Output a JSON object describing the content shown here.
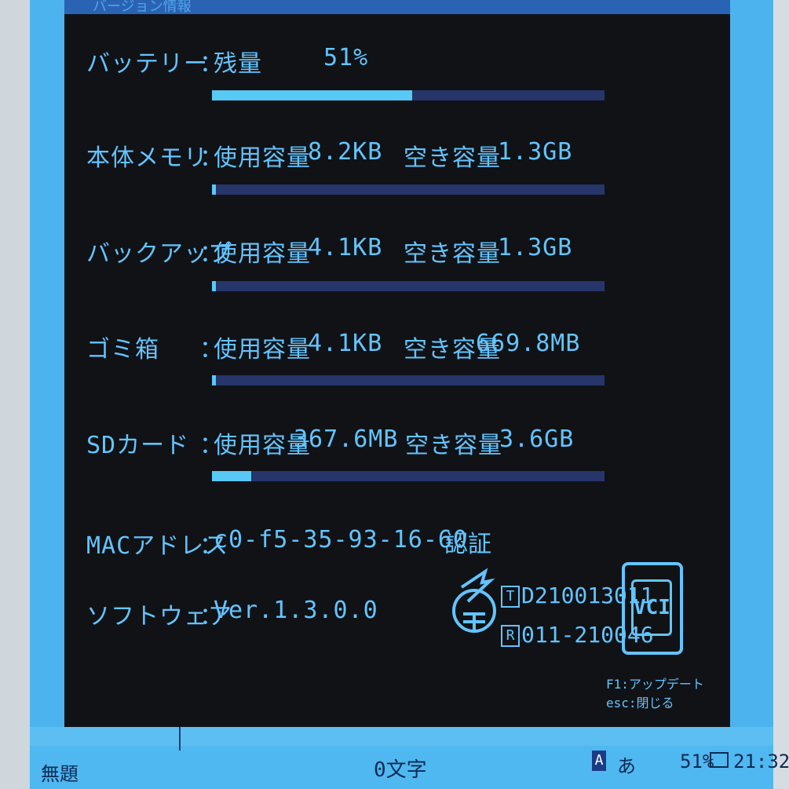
{
  "header": {
    "title": "バージョン情報"
  },
  "battery": {
    "label": "バッテリー",
    "sep": "：",
    "key": "残量",
    "value": "51%",
    "level": 0.51
  },
  "memory": {
    "label": "本体メモリ",
    "sep": "：",
    "used_key": "使用容量",
    "used": "8.2KB",
    "free_key": "空き容量",
    "free": "1.3GB",
    "usage": 0.01
  },
  "backup": {
    "label": "バックアップ",
    "sep": "：",
    "used_key": "使用容量",
    "used": "4.1KB",
    "free_key": "空き容量",
    "free": "1.3GB",
    "usage": 0.01
  },
  "trash": {
    "label": "ゴミ箱",
    "sep": "：",
    "used_key": "使用容量",
    "used": "4.1KB",
    "free_key": "空き容量",
    "free": "669.8MB",
    "usage": 0.01
  },
  "sd": {
    "label": "SDカード",
    "sep": "：",
    "used_key": "使用容量",
    "used": "367.6MB",
    "free_key": "空き容量",
    "free": "3.6GB",
    "usage": 0.1
  },
  "mac": {
    "label": "MACアドレス",
    "sep": "：",
    "value": "c0-f5-35-93-16-60"
  },
  "software": {
    "label": "ソフトウェア",
    "sep": "：",
    "value": "Ver.1.3.0.0"
  },
  "certification": {
    "title": "認証",
    "t_mark": "T",
    "t_code": "D210013011",
    "r_mark": "R",
    "r_code": "011-210046",
    "vcci": "VCI"
  },
  "hints": {
    "text": "F1:アップデート　esc:閉じる"
  },
  "status_bar": {
    "doc": "無題",
    "chars": "0文字",
    "ime_icon": "A",
    "ime": "あ",
    "battery": "51%",
    "clock": "21:32"
  },
  "colors": {
    "accent": "#63c4ff",
    "panel": "#101216",
    "bar_track": "#26356a",
    "bar_fill": "#58c8f5"
  }
}
